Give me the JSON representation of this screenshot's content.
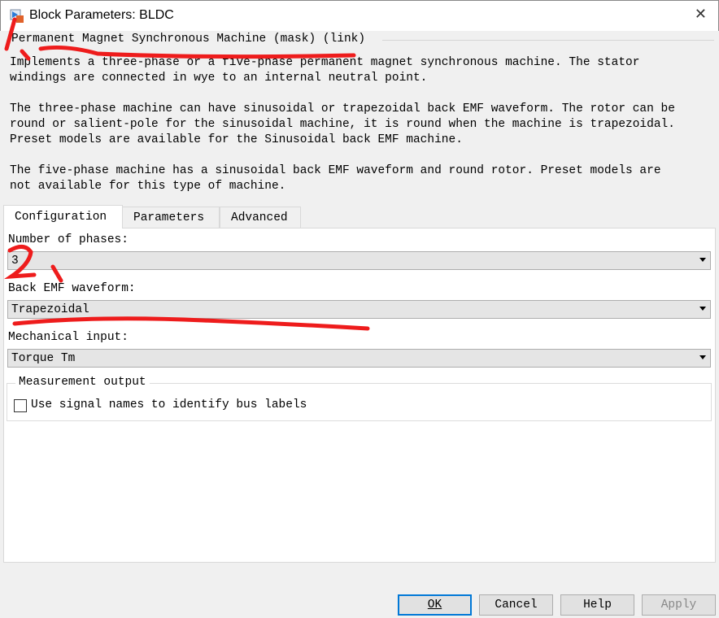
{
  "window": {
    "title": "Block Parameters: BLDC"
  },
  "header": {
    "group_title": "Permanent Magnet Synchronous Machine (mask) (link)",
    "description": [
      "Implements a three-phase or a five-phase permanent magnet synchronous machine. The stator\nwindings are connected in wye to an internal neutral point.",
      "The three-phase machine can have sinusoidal or trapezoidal back EMF waveform. The rotor can be\nround or salient-pole for the sinusoidal machine, it is round when the machine is trapezoidal.\nPreset models are available for the Sinusoidal back EMF machine.",
      "The five-phase machine has a sinusoidal back EMF waveform and round rotor. Preset models are\nnot available for this type of machine."
    ]
  },
  "tabs": [
    {
      "label": "Configuration",
      "active": true
    },
    {
      "label": "Parameters"
    },
    {
      "label": "Advanced"
    }
  ],
  "config": {
    "phases": {
      "label": "Number of phases:",
      "value": "3"
    },
    "waveform": {
      "label": "Back EMF waveform:",
      "value": "Trapezoidal"
    },
    "mech": {
      "label": "Mechanical input:",
      "value": "Torque Tm"
    },
    "measurement": {
      "title": "Measurement output",
      "checkbox_label": "Use signal names to identify bus labels",
      "checked": false
    }
  },
  "buttons": {
    "ok": "OK",
    "cancel": "Cancel",
    "help": "Help",
    "apply": "Apply"
  },
  "annotation_color": "#ee1c1c"
}
